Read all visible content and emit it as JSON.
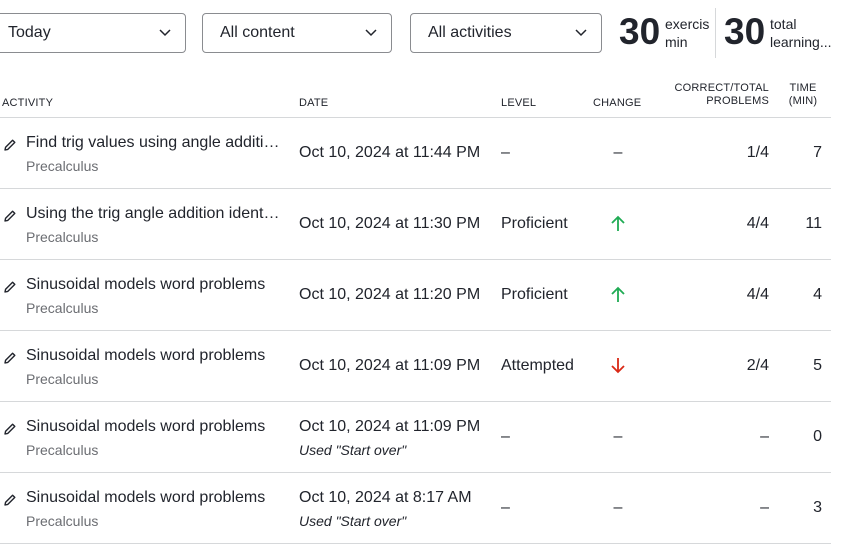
{
  "filters": {
    "period": "Today",
    "content": "All content",
    "activities": "All activities"
  },
  "stats": [
    {
      "value": "30",
      "label_line1": "exercis",
      "label_line2": "min"
    },
    {
      "value": "30",
      "label_line1": "total",
      "label_line2": "learning..."
    }
  ],
  "table": {
    "headers": {
      "activity": "ACTIVITY",
      "date": "DATE",
      "level": "LEVEL",
      "change": "CHANGE",
      "correct_line1": "CORRECT/TOTAL",
      "correct_line2": "PROBLEMS",
      "time_line1": "TIME",
      "time_line2": "(MIN)"
    },
    "rows": [
      {
        "title": "Find trig values using angle addition identities",
        "course": "Precalculus",
        "date": "Oct 10, 2024 at 11:44 PM",
        "note": "",
        "level": "–",
        "change": "–",
        "correct": "1/4",
        "time": "7"
      },
      {
        "title": "Using the trig angle addition identities",
        "course": "Precalculus",
        "date": "Oct 10, 2024 at 11:30 PM",
        "note": "",
        "level": "Proficient",
        "change": "up",
        "correct": "4/4",
        "time": "11"
      },
      {
        "title": "Sinusoidal models word problems",
        "course": "Precalculus",
        "date": "Oct 10, 2024 at 11:20 PM",
        "note": "",
        "level": "Proficient",
        "change": "up",
        "correct": "4/4",
        "time": "4"
      },
      {
        "title": "Sinusoidal models word problems",
        "course": "Precalculus",
        "date": "Oct 10, 2024 at 11:09 PM",
        "note": "",
        "level": "Attempted",
        "change": "down",
        "correct": "2/4",
        "time": "5"
      },
      {
        "title": "Sinusoidal models word problems",
        "course": "Precalculus",
        "date": "Oct 10, 2024 at 11:09 PM",
        "note": "Used \"Start over\"",
        "level": "–",
        "change": "–",
        "correct": "–",
        "time": "0"
      },
      {
        "title": "Sinusoidal models word problems",
        "course": "Precalculus",
        "date": "Oct 10, 2024 at 8:17 AM",
        "note": "Used \"Start over\"",
        "level": "–",
        "change": "–",
        "correct": "–",
        "time": "3"
      }
    ]
  },
  "colors": {
    "up": "#1fab54",
    "down": "#d92916"
  },
  "icons": {
    "row": "pencil-icon",
    "dropdown": "chevron-down-icon"
  }
}
